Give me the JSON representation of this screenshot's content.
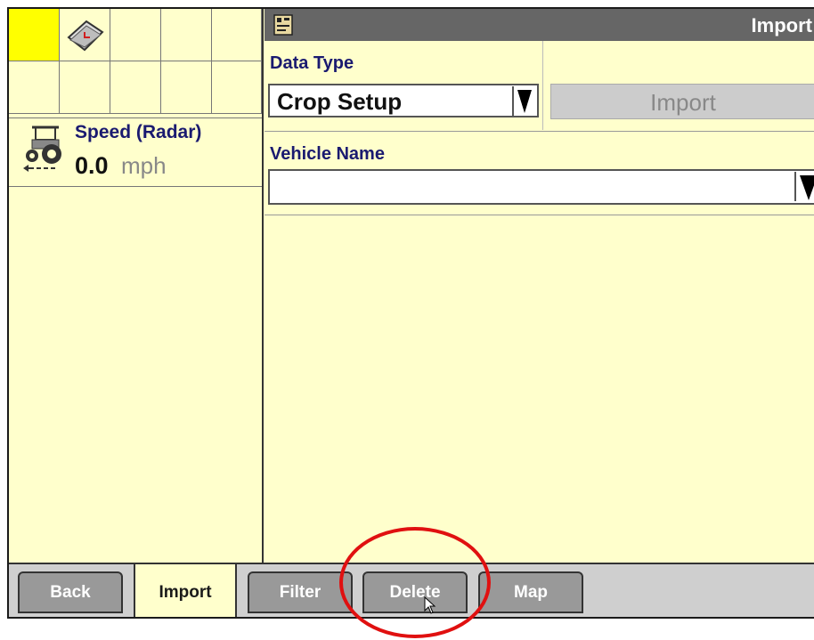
{
  "left_panel": {
    "speed_label": "Speed (Radar)",
    "speed_value": "0.0",
    "speed_unit": "mph"
  },
  "titlebar": {
    "title": "Import"
  },
  "form": {
    "data_type_label": "Data Type",
    "data_type_value": "Crop Setup",
    "import_button_label": "Import",
    "vehicle_name_label": "Vehicle Name",
    "vehicle_name_value": ""
  },
  "tabs": [
    {
      "label": "Back"
    },
    {
      "label": "Import"
    },
    {
      "label": "Filter"
    },
    {
      "label": "Delete"
    },
    {
      "label": "Map"
    }
  ],
  "colors": {
    "panel_background": "#ffffcc",
    "title_bar": "#666666",
    "label_text": "#1a1a70",
    "active_cell": "#ffff00",
    "annotation": "#e01010"
  }
}
